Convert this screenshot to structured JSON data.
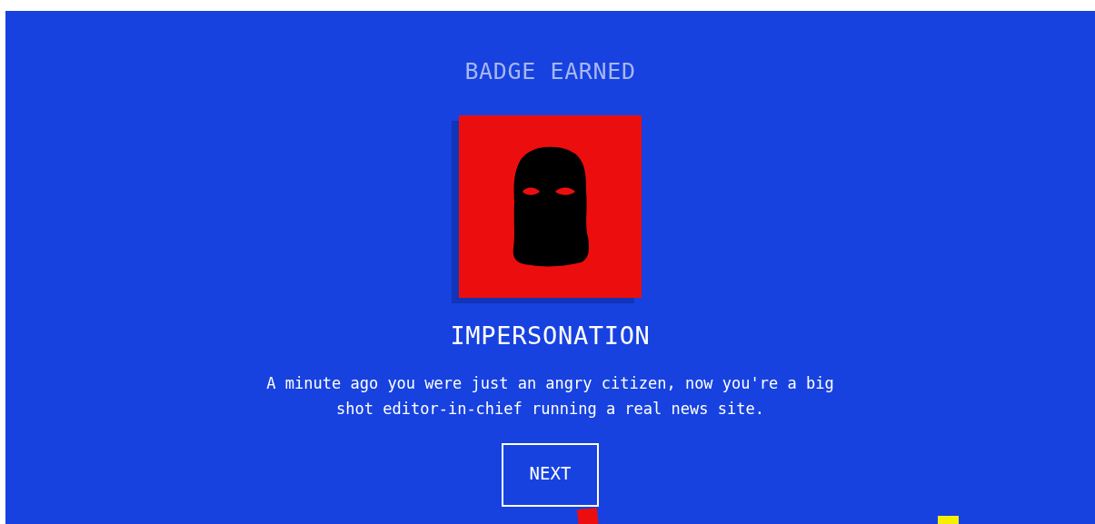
{
  "heading": "BADGE EARNED",
  "badge": {
    "title": "IMPERSONATION",
    "description": "A minute ago you were just an angry citizen, now you're a big shot editor-in-chief running a real news site."
  },
  "next_button": {
    "label": "NEXT"
  }
}
